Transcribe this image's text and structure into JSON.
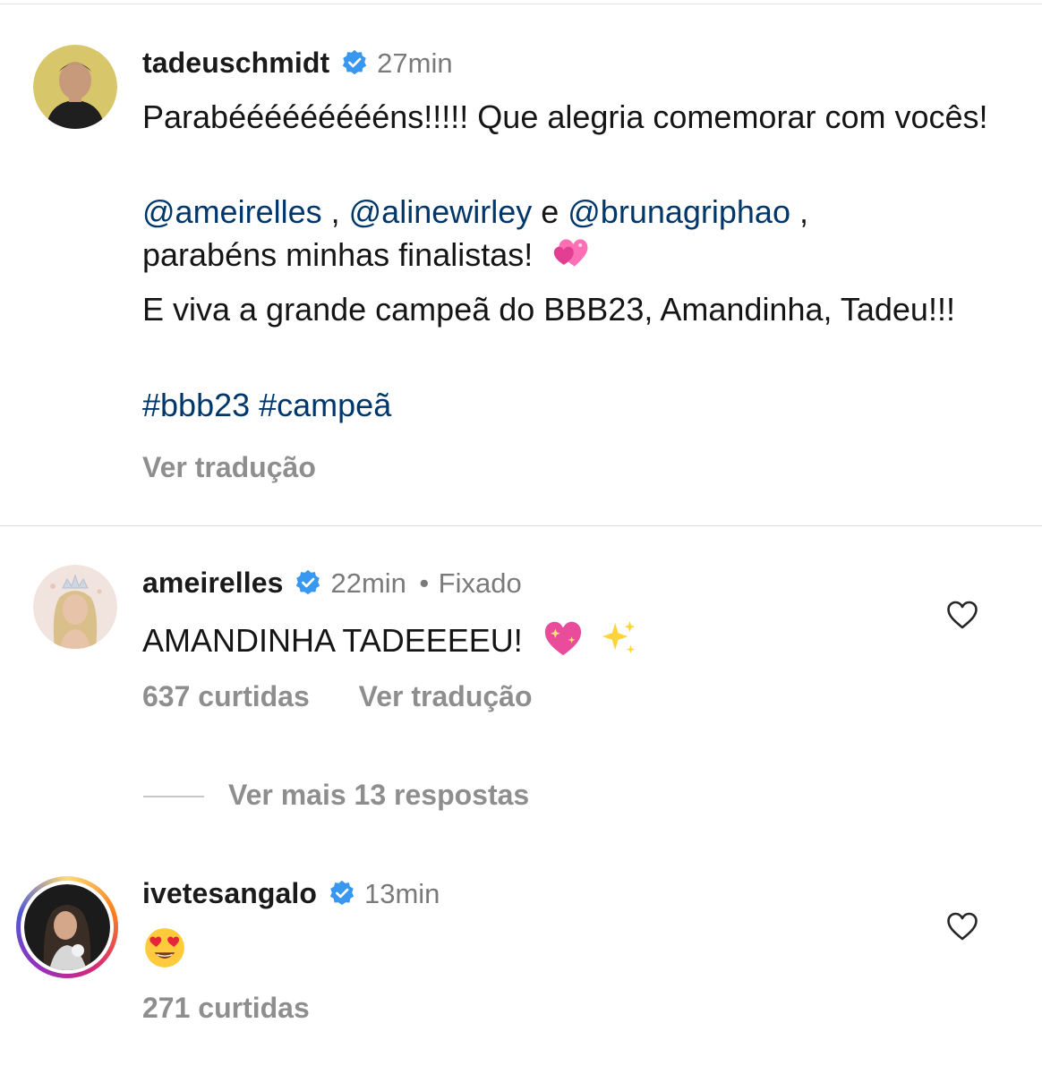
{
  "caption": {
    "username": "tadeuschmidt",
    "time": "27min",
    "line1": "Parabéééééééééns!!!!! Que alegria comemorar com vocês!",
    "mentions": [
      "@ameirelles",
      "@alinewirley",
      "@brunagriphao"
    ],
    "sep1": " , ",
    "sep2": " e ",
    "sep3": " ,",
    "line2_rest": "parabéns minhas finalistas!",
    "line3": "E viva a grande campeã do BBB23, Amandinha, Tadeu!!!",
    "hashtags": "#bbb23 #campeã",
    "translate": "Ver tradução"
  },
  "comments": [
    {
      "username": "ameirelles",
      "time": "22min",
      "dot": "•",
      "pinned": "Fixado",
      "text": "AMANDINHA TADEEEEU!",
      "likes": "637 curtidas",
      "translate": "Ver tradução",
      "more_replies": "Ver mais 13 respostas"
    },
    {
      "username": "ivetesangalo",
      "time": "13min",
      "likes": "271 curtidas"
    }
  ],
  "icons": {
    "verified": "verified-badge-icon",
    "heart": "heart-outline-icon",
    "sparkling_heart": "sparkling-heart-emoji",
    "sparkles": "sparkles-emoji",
    "two_hearts": "two-hearts-emoji",
    "heart_eyes": "heart-eyes-emoji"
  },
  "colors": {
    "link": "#00376b",
    "muted": "#8e8e8e",
    "verified": "#3897f0"
  }
}
